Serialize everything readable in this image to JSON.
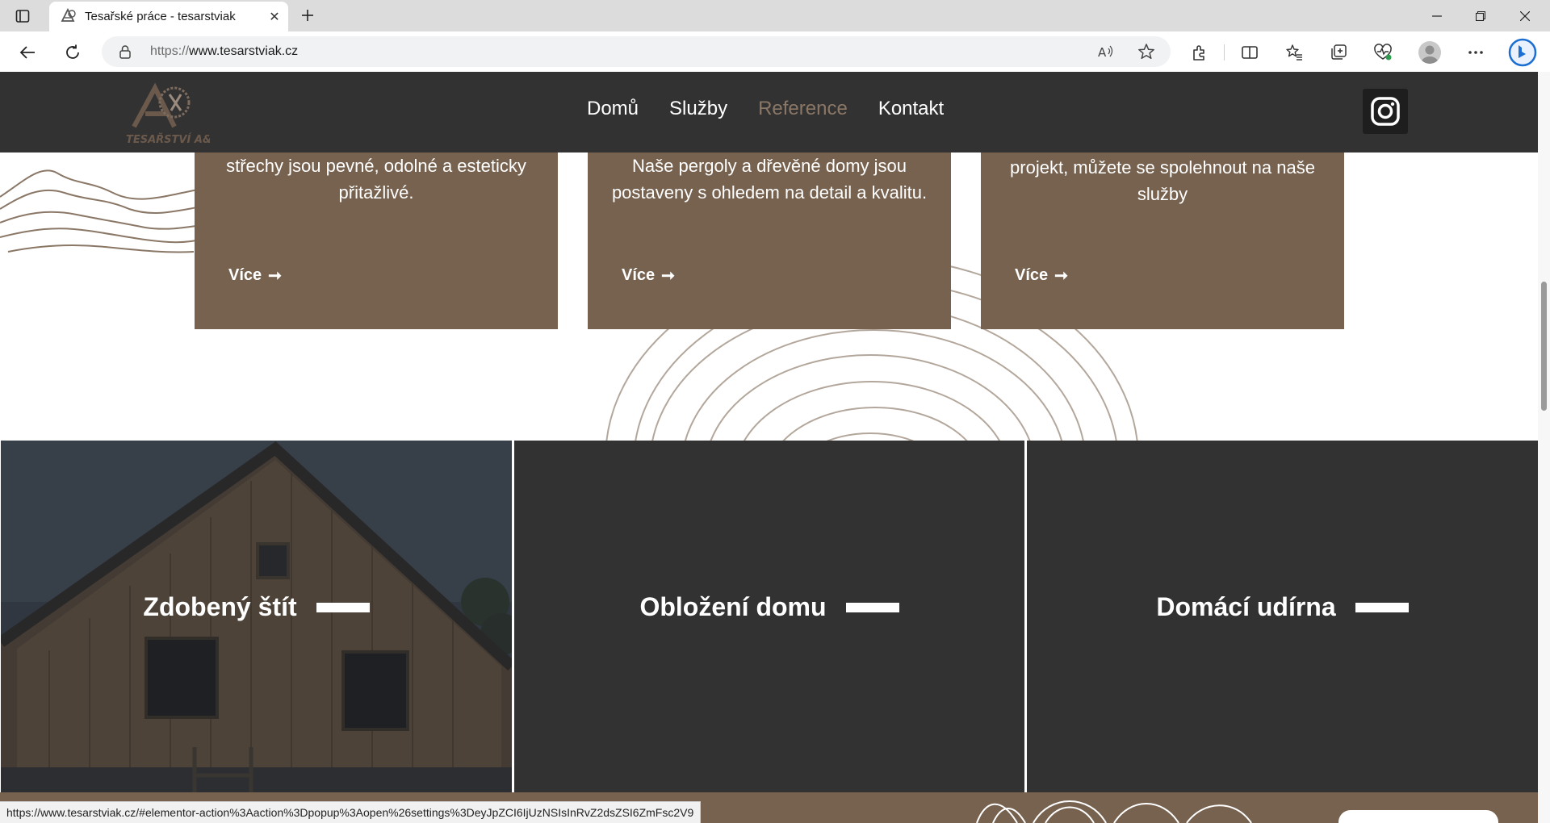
{
  "browser": {
    "tab_title": "Tesařské práce - tesarstviak",
    "url_protocol": "https://",
    "url_host": "www.tesarstviak.cz",
    "icons": [
      "tab-actions-icon",
      "favicon",
      "close-icon",
      "plus-icon",
      "minimize-icon",
      "restore-icon",
      "close-window-icon",
      "back-icon",
      "refresh-icon",
      "lock-icon",
      "read-aloud-icon",
      "favorite-star-icon",
      "extensions-icon",
      "split-screen-icon",
      "favorites-icon",
      "collections-icon",
      "browser-essentials-icon",
      "profile-icon",
      "more-icon",
      "copilot-icon"
    ]
  },
  "site": {
    "logo_text": "TESAŘSTVÍ A&K",
    "nav": [
      {
        "label": "Domů"
      },
      {
        "label": "Služby"
      },
      {
        "label": "Reference"
      },
      {
        "label": "Kontakt"
      }
    ],
    "active_nav": "Reference",
    "colors": {
      "brand_brown": "#77624f",
      "dark": "#333232",
      "active_nav": "#8a7766"
    }
  },
  "cards": [
    {
      "text": "střechy jsou pevné, odolné a esteticky přitažlivé.",
      "more": "Více"
    },
    {
      "text": "Naše pergoly a dřevěné domy jsou postaveny s ohledem na detail a kvalitu.",
      "more": "Více"
    },
    {
      "text": "ohledu na to, jak velký nebo malý je váš projekt, můžete se spolehnout na naše služby",
      "more": "Více"
    }
  ],
  "tiles": [
    {
      "label": "Zdobený štít"
    },
    {
      "label": "Obložení domu"
    },
    {
      "label": "Domácí udírna"
    }
  ],
  "status_url": "https://www.tesarstviak.cz/#elementor-action%3Aaction%3Dpopup%3Aopen%26settings%3DeyJpZCI6IjUzNSIsInRvZ2dsZSI6ZmFsc2V9"
}
